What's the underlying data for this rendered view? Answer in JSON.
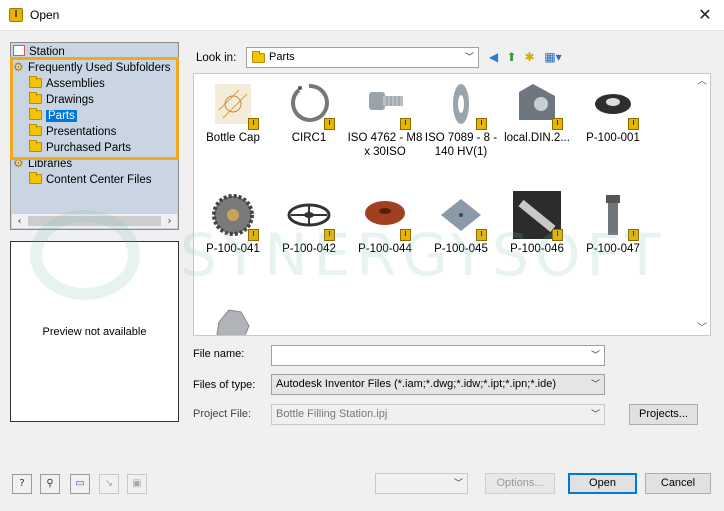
{
  "window": {
    "title": "Open",
    "close_glyph": "✕",
    "app_icon_glyph": "I"
  },
  "tree": {
    "items": [
      {
        "label": "Station",
        "icon": "station-icon"
      },
      {
        "label": "Frequently Used Subfolders",
        "icon": "favorites-icon"
      },
      {
        "label": "Assemblies",
        "icon": "folder-icon"
      },
      {
        "label": "Drawings",
        "icon": "folder-icon"
      },
      {
        "label": "Parts",
        "icon": "folder-icon",
        "selected": true
      },
      {
        "label": "Presentations",
        "icon": "folder-icon"
      },
      {
        "label": "Purchased Parts",
        "icon": "folder-icon"
      },
      {
        "label": "Libraries",
        "icon": "favorites-icon"
      },
      {
        "label": "Content Center Files",
        "icon": "folder-icon"
      }
    ],
    "highlight_color": "#f2a81d",
    "selection_color": "#0078d7"
  },
  "preview": {
    "text": "Preview not available"
  },
  "look_in": {
    "label": "Look in:",
    "value": "Parts"
  },
  "files": [
    {
      "name": "Bottle Cap",
      "kind": "cap"
    },
    {
      "name": "CIRC1",
      "kind": "ring"
    },
    {
      "name": "ISO 4762 - M8 x 30ISO",
      "kind": "bolt"
    },
    {
      "name": "ISO 7089 - 8 - 140 HV(1)",
      "kind": "washer"
    },
    {
      "name": "local.DIN.2...",
      "kind": "bracket"
    },
    {
      "name": "P-100-001",
      "kind": "nut"
    },
    {
      "name": "P-100-041",
      "kind": "gear"
    },
    {
      "name": "P-100-042",
      "kind": "wheel"
    },
    {
      "name": "P-100-044",
      "kind": "disc"
    },
    {
      "name": "P-100-045",
      "kind": "plate"
    },
    {
      "name": "P-100-046",
      "kind": "shaft"
    },
    {
      "name": "P-100-047",
      "kind": "pin"
    },
    {
      "name": "",
      "kind": "sprocket"
    }
  ],
  "form": {
    "file_name_label": "File name:",
    "file_name_value": "",
    "files_of_type_label": "Files of type:",
    "files_of_type_value": "Autodesk Inventor Files (*.iam;*.dwg;*.idw;*.ipt;*.ipn;*.ide)",
    "project_file_label": "Project File:",
    "project_file_value": "Bottle Filling Station.ipj",
    "projects_button": "Projects..."
  },
  "footer": {
    "options_button": "Options...",
    "open_button": "Open",
    "cancel_button": "Cancel"
  },
  "watermark": {
    "text": "SYNERGYSOFT"
  }
}
